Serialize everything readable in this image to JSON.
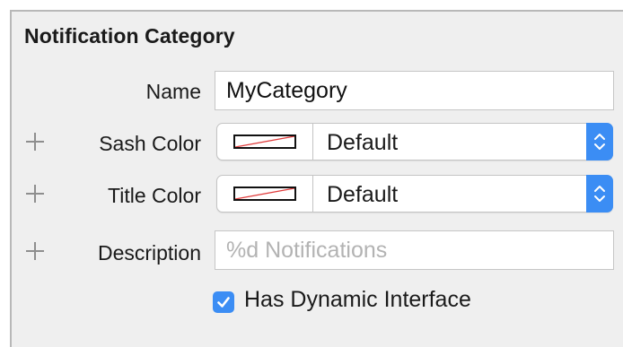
{
  "panel": {
    "title": "Notification Category"
  },
  "fields": {
    "name": {
      "label": "Name",
      "value": "MyCategory"
    },
    "sash_color": {
      "label": "Sash Color",
      "value": "Default",
      "swatch_icon": "no-color-swatch-icon",
      "stepper_icon": "up-down-chevron-icon"
    },
    "title_color": {
      "label": "Title Color",
      "value": "Default",
      "swatch_icon": "no-color-swatch-icon",
      "stepper_icon": "up-down-chevron-icon"
    },
    "description": {
      "label": "Description",
      "value": "",
      "placeholder": "%d Notifications"
    },
    "dynamic_interface": {
      "label": "Has Dynamic Interface",
      "checked": true
    }
  },
  "colors": {
    "panel_bg": "#efefef",
    "accent": "#3b8df4",
    "plus": "#8e8e8e",
    "swatch_slash": "#e03a3a"
  }
}
